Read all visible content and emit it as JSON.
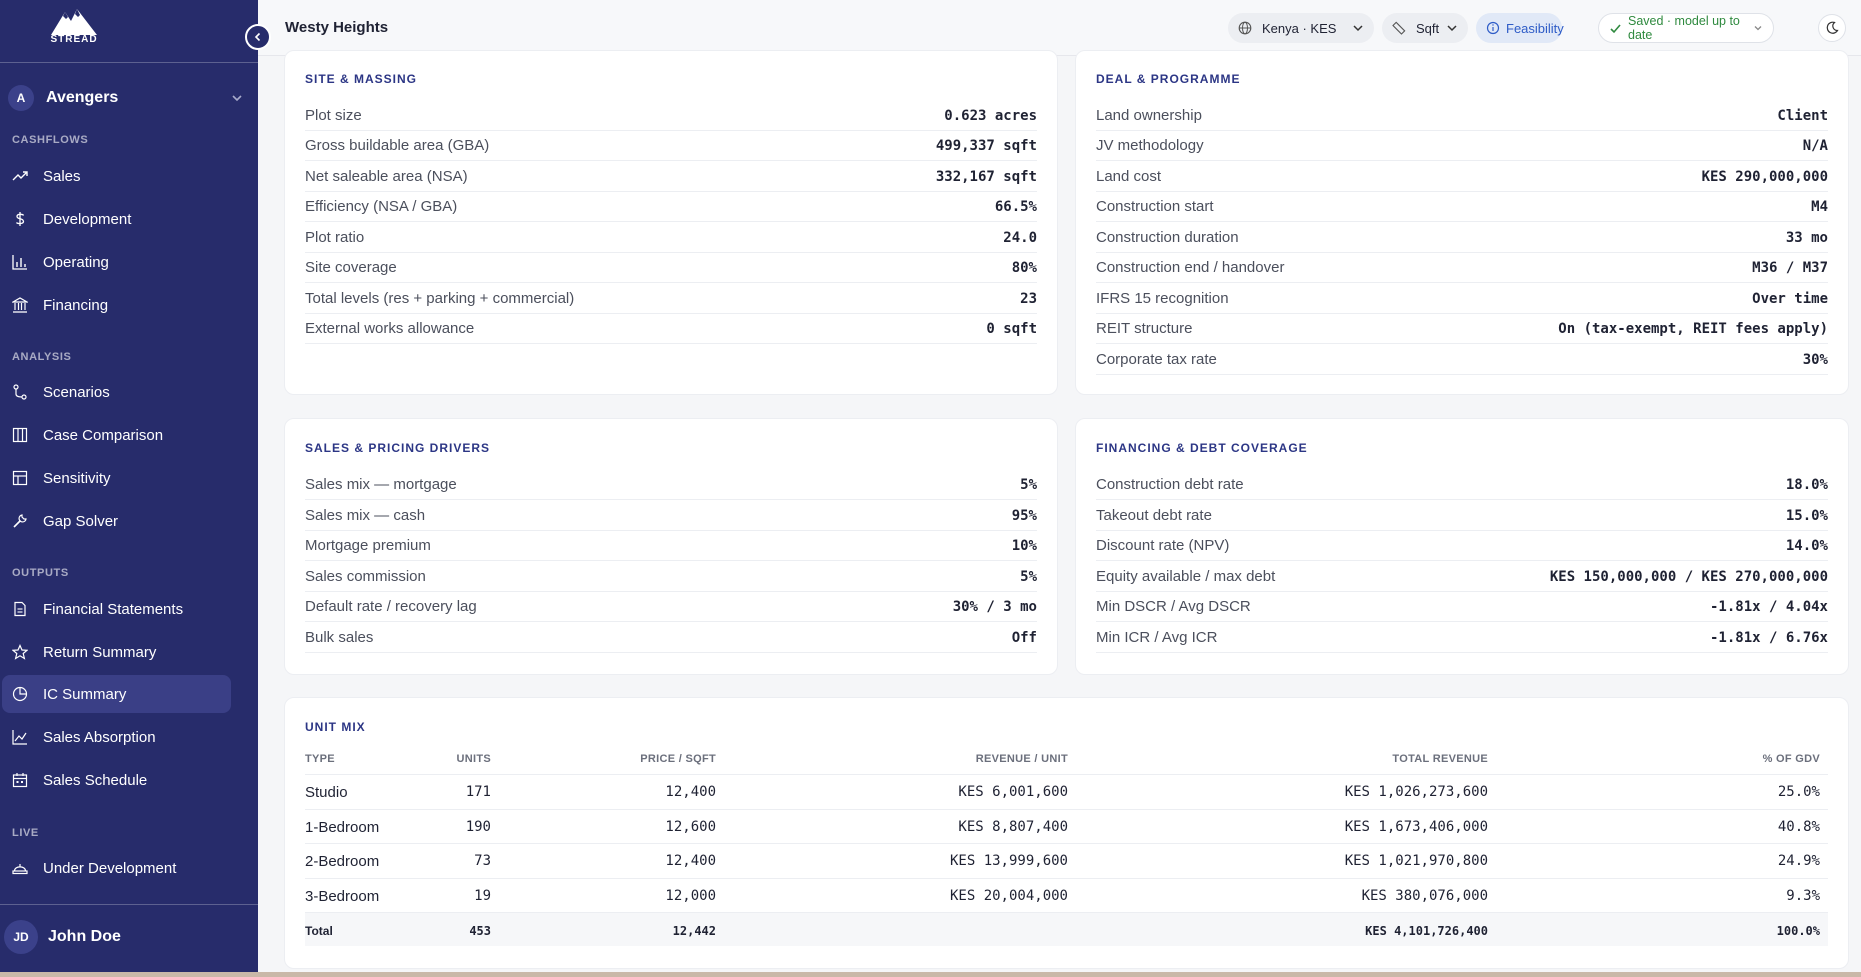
{
  "app": {
    "logo_text": "STREAD"
  },
  "workspace": {
    "initial": "A",
    "name": "Avengers"
  },
  "sidebar": {
    "sections": [
      {
        "title": "CASHFLOWS",
        "items": [
          {
            "label": "Sales",
            "icon": "trending-up-icon"
          },
          {
            "label": "Development",
            "icon": "dollar-icon"
          },
          {
            "label": "Operating",
            "icon": "bar-chart-icon"
          },
          {
            "label": "Financing",
            "icon": "bank-icon"
          }
        ]
      },
      {
        "title": "ANALYSIS",
        "items": [
          {
            "label": "Scenarios",
            "icon": "branch-icon"
          },
          {
            "label": "Case Comparison",
            "icon": "columns-icon"
          },
          {
            "label": "Sensitivity",
            "icon": "table-icon"
          },
          {
            "label": "Gap Solver",
            "icon": "wrench-icon"
          }
        ]
      },
      {
        "title": "OUTPUTS",
        "items": [
          {
            "label": "Financial Statements",
            "icon": "document-icon"
          },
          {
            "label": "Return Summary",
            "icon": "star-icon"
          },
          {
            "label": "IC Summary",
            "icon": "pie-icon",
            "active": true
          },
          {
            "label": "Sales Absorption",
            "icon": "line-chart-icon"
          },
          {
            "label": "Sales Schedule",
            "icon": "calendar-icon"
          }
        ]
      },
      {
        "title": "LIVE",
        "items": [
          {
            "label": "Under Development",
            "icon": "hardhat-icon"
          }
        ]
      }
    ]
  },
  "user": {
    "initials": "JD",
    "name": "John Doe"
  },
  "header": {
    "title": "Westy Heights",
    "region": "Kenya · KES",
    "unit": "Sqft",
    "stage": "Feasibility",
    "status": "Saved · model up to date"
  },
  "site": {
    "title": "SITE & MASSING",
    "rows": [
      {
        "k": "Plot size",
        "v": "0.623 acres"
      },
      {
        "k": "Gross buildable area (GBA)",
        "v": "499,337 sqft"
      },
      {
        "k": "Net saleable area (NSA)",
        "v": "332,167 sqft"
      },
      {
        "k": "Efficiency (NSA / GBA)",
        "v": "66.5%"
      },
      {
        "k": "Plot ratio",
        "v": "24.0"
      },
      {
        "k": "Site coverage",
        "v": "80%"
      },
      {
        "k": "Total levels (res + parking + commercial)",
        "v": "23"
      },
      {
        "k": "External works allowance",
        "v": "0 sqft"
      }
    ]
  },
  "deal": {
    "title": "DEAL & PROGRAMME",
    "rows": [
      {
        "k": "Land ownership",
        "v": "Client"
      },
      {
        "k": "JV methodology",
        "v": "N/A"
      },
      {
        "k": "Land cost",
        "v": "KES 290,000,000"
      },
      {
        "k": "Construction start",
        "v": "M4"
      },
      {
        "k": "Construction duration",
        "v": "33 mo"
      },
      {
        "k": "Construction end / handover",
        "v": "M36 / M37"
      },
      {
        "k": "IFRS 15 recognition",
        "v": "Over time"
      },
      {
        "k": "REIT structure",
        "v": "On (tax-exempt, REIT fees apply)"
      },
      {
        "k": "Corporate tax rate",
        "v": "30%"
      }
    ]
  },
  "sales": {
    "title": "SALES & PRICING DRIVERS",
    "rows": [
      {
        "k": "Sales mix — mortgage",
        "v": "5%"
      },
      {
        "k": "Sales mix — cash",
        "v": "95%"
      },
      {
        "k": "Mortgage premium",
        "v": "10%"
      },
      {
        "k": "Sales commission",
        "v": "5%"
      },
      {
        "k": "Default rate / recovery lag",
        "v": "30% / 3 mo"
      },
      {
        "k": "Bulk sales",
        "v": "Off"
      }
    ]
  },
  "financing": {
    "title": "FINANCING & DEBT COVERAGE",
    "rows": [
      {
        "k": "Construction debt rate",
        "v": "18.0%"
      },
      {
        "k": "Takeout debt rate",
        "v": "15.0%"
      },
      {
        "k": "Discount rate (NPV)",
        "v": "14.0%"
      },
      {
        "k": "Equity available / max debt",
        "v": "KES 150,000,000 / KES 270,000,000"
      },
      {
        "k": "Min DSCR / Avg DSCR",
        "v": "-1.81x / 4.04x"
      },
      {
        "k": "Min ICR / Avg ICR",
        "v": "-1.81x / 6.76x"
      }
    ]
  },
  "unit_mix": {
    "title": "UNIT MIX",
    "headers": [
      "TYPE",
      "UNITS",
      "PRICE / SQFT",
      "REVENUE / UNIT",
      "TOTAL REVENUE",
      "% OF GDV"
    ],
    "rows": [
      [
        "Studio",
        "171",
        "12,400",
        "KES 6,001,600",
        "KES 1,026,273,600",
        "25.0%"
      ],
      [
        "1-Bedroom",
        "190",
        "12,600",
        "KES 8,807,400",
        "KES 1,673,406,000",
        "40.8%"
      ],
      [
        "2-Bedroom",
        "73",
        "12,400",
        "KES 13,999,600",
        "KES 1,021,970,800",
        "24.9%"
      ],
      [
        "3-Bedroom",
        "19",
        "12,000",
        "KES 20,004,000",
        "KES 380,076,000",
        "9.3%"
      ]
    ],
    "total": [
      "Total",
      "453",
      "12,442",
      "",
      "KES 4,101,726,400",
      "100.0%"
    ]
  },
  "colors": {
    "sidebar": "#272c6b",
    "accent": "#2c3685",
    "saved": "#2f8a3f",
    "stage": "#2e5cc7"
  }
}
